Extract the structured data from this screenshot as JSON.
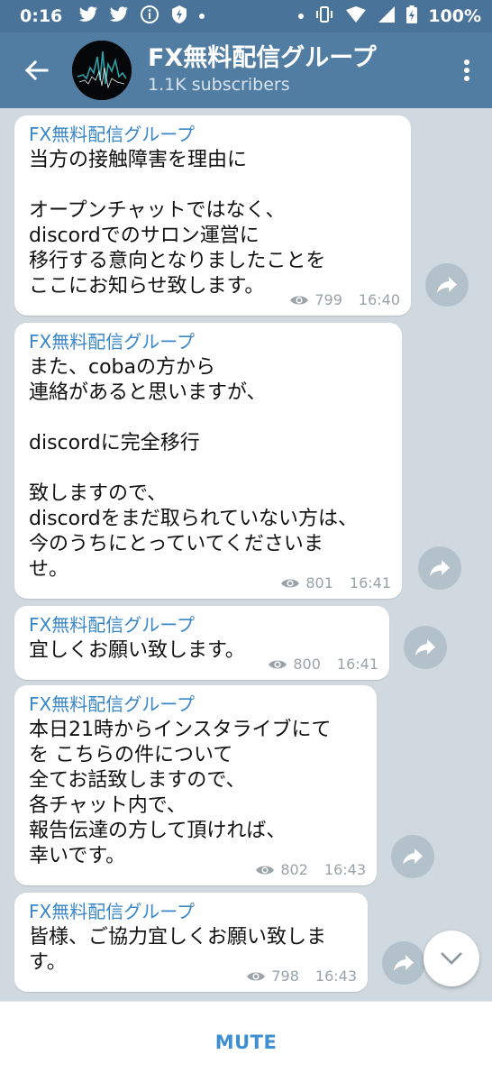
{
  "status_bar": {
    "time": "0:16",
    "battery": "100%"
  },
  "header": {
    "title": "FX無料配信グループ",
    "subscribers": "1.1K subscribers"
  },
  "messages": [
    {
      "sender": "FX無料配信グループ",
      "text": "当方の接触障害を理由に\n\nオープンチャットではなく、\ndiscordでのサロン運営に\n移行する意向となりましたことを\nここにお知らせ致します。",
      "views": "799",
      "time": "16:40"
    },
    {
      "sender": "FX無料配信グループ",
      "text": "また、cobaの方から\n連絡があると思いますが、\n\ndiscordに完全移行\n\n致しますので、\ndiscordをまだ取られていない方は、\n今のうちにとっていてくださいま\nせ。",
      "views": "801",
      "time": "16:41"
    },
    {
      "sender": "FX無料配信グループ",
      "text": "宜しくお願い致します。",
      "views": "800",
      "time": "16:41"
    },
    {
      "sender": "FX無料配信グループ",
      "text": "本日21時からインスタライブにて\nを こちらの件について\n全てお話致しますので、\n各チャット内で、\n報告伝達の方して頂ければ、\n幸いです。",
      "views": "802",
      "time": "16:43"
    },
    {
      "sender": "FX無料配信グループ",
      "text": "皆様、ご協力宜しくお願い致しま\nす。",
      "views": "798",
      "time": "16:43"
    }
  ],
  "bottom_bar": {
    "mute_label": "MUTE"
  },
  "colors": {
    "header": "#527da3",
    "status_bar": "#4a7399",
    "accent": "#3d8fd1",
    "chat_background": "#cfd9df"
  }
}
